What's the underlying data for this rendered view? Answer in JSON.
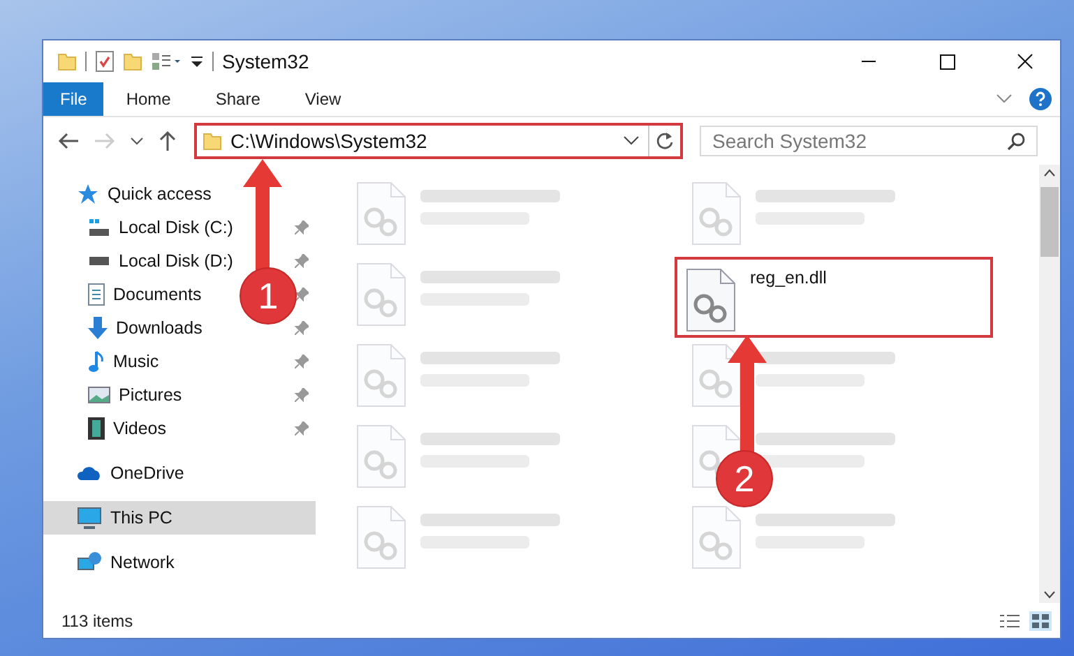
{
  "window": {
    "title": "System32"
  },
  "ribbon_tabs": [
    {
      "label": "File",
      "selected": true
    },
    {
      "label": "Home",
      "selected": false
    },
    {
      "label": "Share",
      "selected": false
    },
    {
      "label": "View",
      "selected": false
    }
  ],
  "address_bar": {
    "value": "C:\\Windows\\System32",
    "highlighted": true
  },
  "search": {
    "placeholder": "Search System32"
  },
  "sidebar": {
    "items": [
      {
        "label": "Quick access",
        "kind": "star",
        "selected": false,
        "children": [
          {
            "label": "Local Disk (C:)",
            "kind": "system-drive",
            "pinned": true
          },
          {
            "label": "Local Disk (D:)",
            "kind": "drive",
            "pinned": true
          },
          {
            "label": "Documents",
            "kind": "document",
            "pinned": true
          },
          {
            "label": "Downloads",
            "kind": "download",
            "pinned": true
          },
          {
            "label": "Music",
            "kind": "music",
            "pinned": true
          },
          {
            "label": "Pictures",
            "kind": "pictures",
            "pinned": true
          },
          {
            "label": "Videos",
            "kind": "videos",
            "pinned": true
          }
        ]
      },
      {
        "label": "OneDrive",
        "kind": "cloud",
        "selected": false
      },
      {
        "label": "This PC",
        "kind": "computer",
        "selected": true
      },
      {
        "label": "Network",
        "kind": "network",
        "selected": false
      }
    ]
  },
  "files": [
    {
      "blurred": true,
      "highlighted": false
    },
    {
      "blurred": true,
      "highlighted": false
    },
    {
      "blurred": true,
      "highlighted": false
    },
    {
      "name": "reg_en.dll",
      "blurred": false,
      "highlighted": true
    },
    {
      "blurred": true,
      "highlighted": false
    },
    {
      "blurred": true,
      "highlighted": false
    },
    {
      "blurred": true,
      "highlighted": false
    },
    {
      "blurred": true,
      "highlighted": false
    },
    {
      "blurred": true,
      "highlighted": false
    },
    {
      "blurred": true,
      "highlighted": false
    }
  ],
  "status_bar": {
    "item_count": "113 items"
  },
  "annotations": [
    {
      "number": "1"
    },
    {
      "number": "2"
    }
  ]
}
